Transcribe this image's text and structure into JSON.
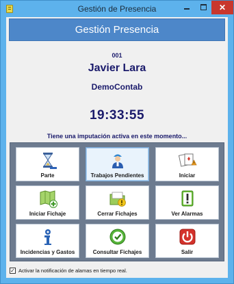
{
  "window": {
    "title": "Gestión de Presencia",
    "close_glyph": "✕"
  },
  "header": {
    "banner": "Gestión Presencia"
  },
  "user": {
    "code": "001",
    "name": "Javier Lara",
    "company": "DemoContab"
  },
  "clock": {
    "time": "19:33:55"
  },
  "status": {
    "message": "Tiene una imputación activa en este momento..."
  },
  "actions": [
    {
      "id": "parte",
      "label": "Parte",
      "icon": "hourglass-icon"
    },
    {
      "id": "trabajos",
      "label": "Trabajos Pendientes",
      "icon": "worker-icon"
    },
    {
      "id": "iniciar",
      "label": "Iniciar",
      "icon": "cards-icon"
    },
    {
      "id": "iniciar-fichaje",
      "label": "Iniciar Fichaje",
      "icon": "map-add-icon"
    },
    {
      "id": "cerrar",
      "label": "Cerrar Fichajes",
      "icon": "folder-warning-icon"
    },
    {
      "id": "alarmas",
      "label": "Ver Alarmas",
      "icon": "alert-icon"
    },
    {
      "id": "incidencias",
      "label": "Incidencias y Gastos",
      "icon": "info-person-icon"
    },
    {
      "id": "consultar",
      "label": "Consultar Fichajes",
      "icon": "refresh-check-icon"
    },
    {
      "id": "salir",
      "label": "Salir",
      "icon": "power-icon"
    }
  ],
  "footer": {
    "notify_label": "Activar la notificación de alamas en tiempo real.",
    "notify_checked": true,
    "check_glyph": "✓"
  },
  "colors": {
    "frame": "#5db2ec",
    "banner": "#4d87c9",
    "text_navy": "#1a1a6b",
    "panel": "#6d7b8f",
    "close": "#c8372d"
  }
}
